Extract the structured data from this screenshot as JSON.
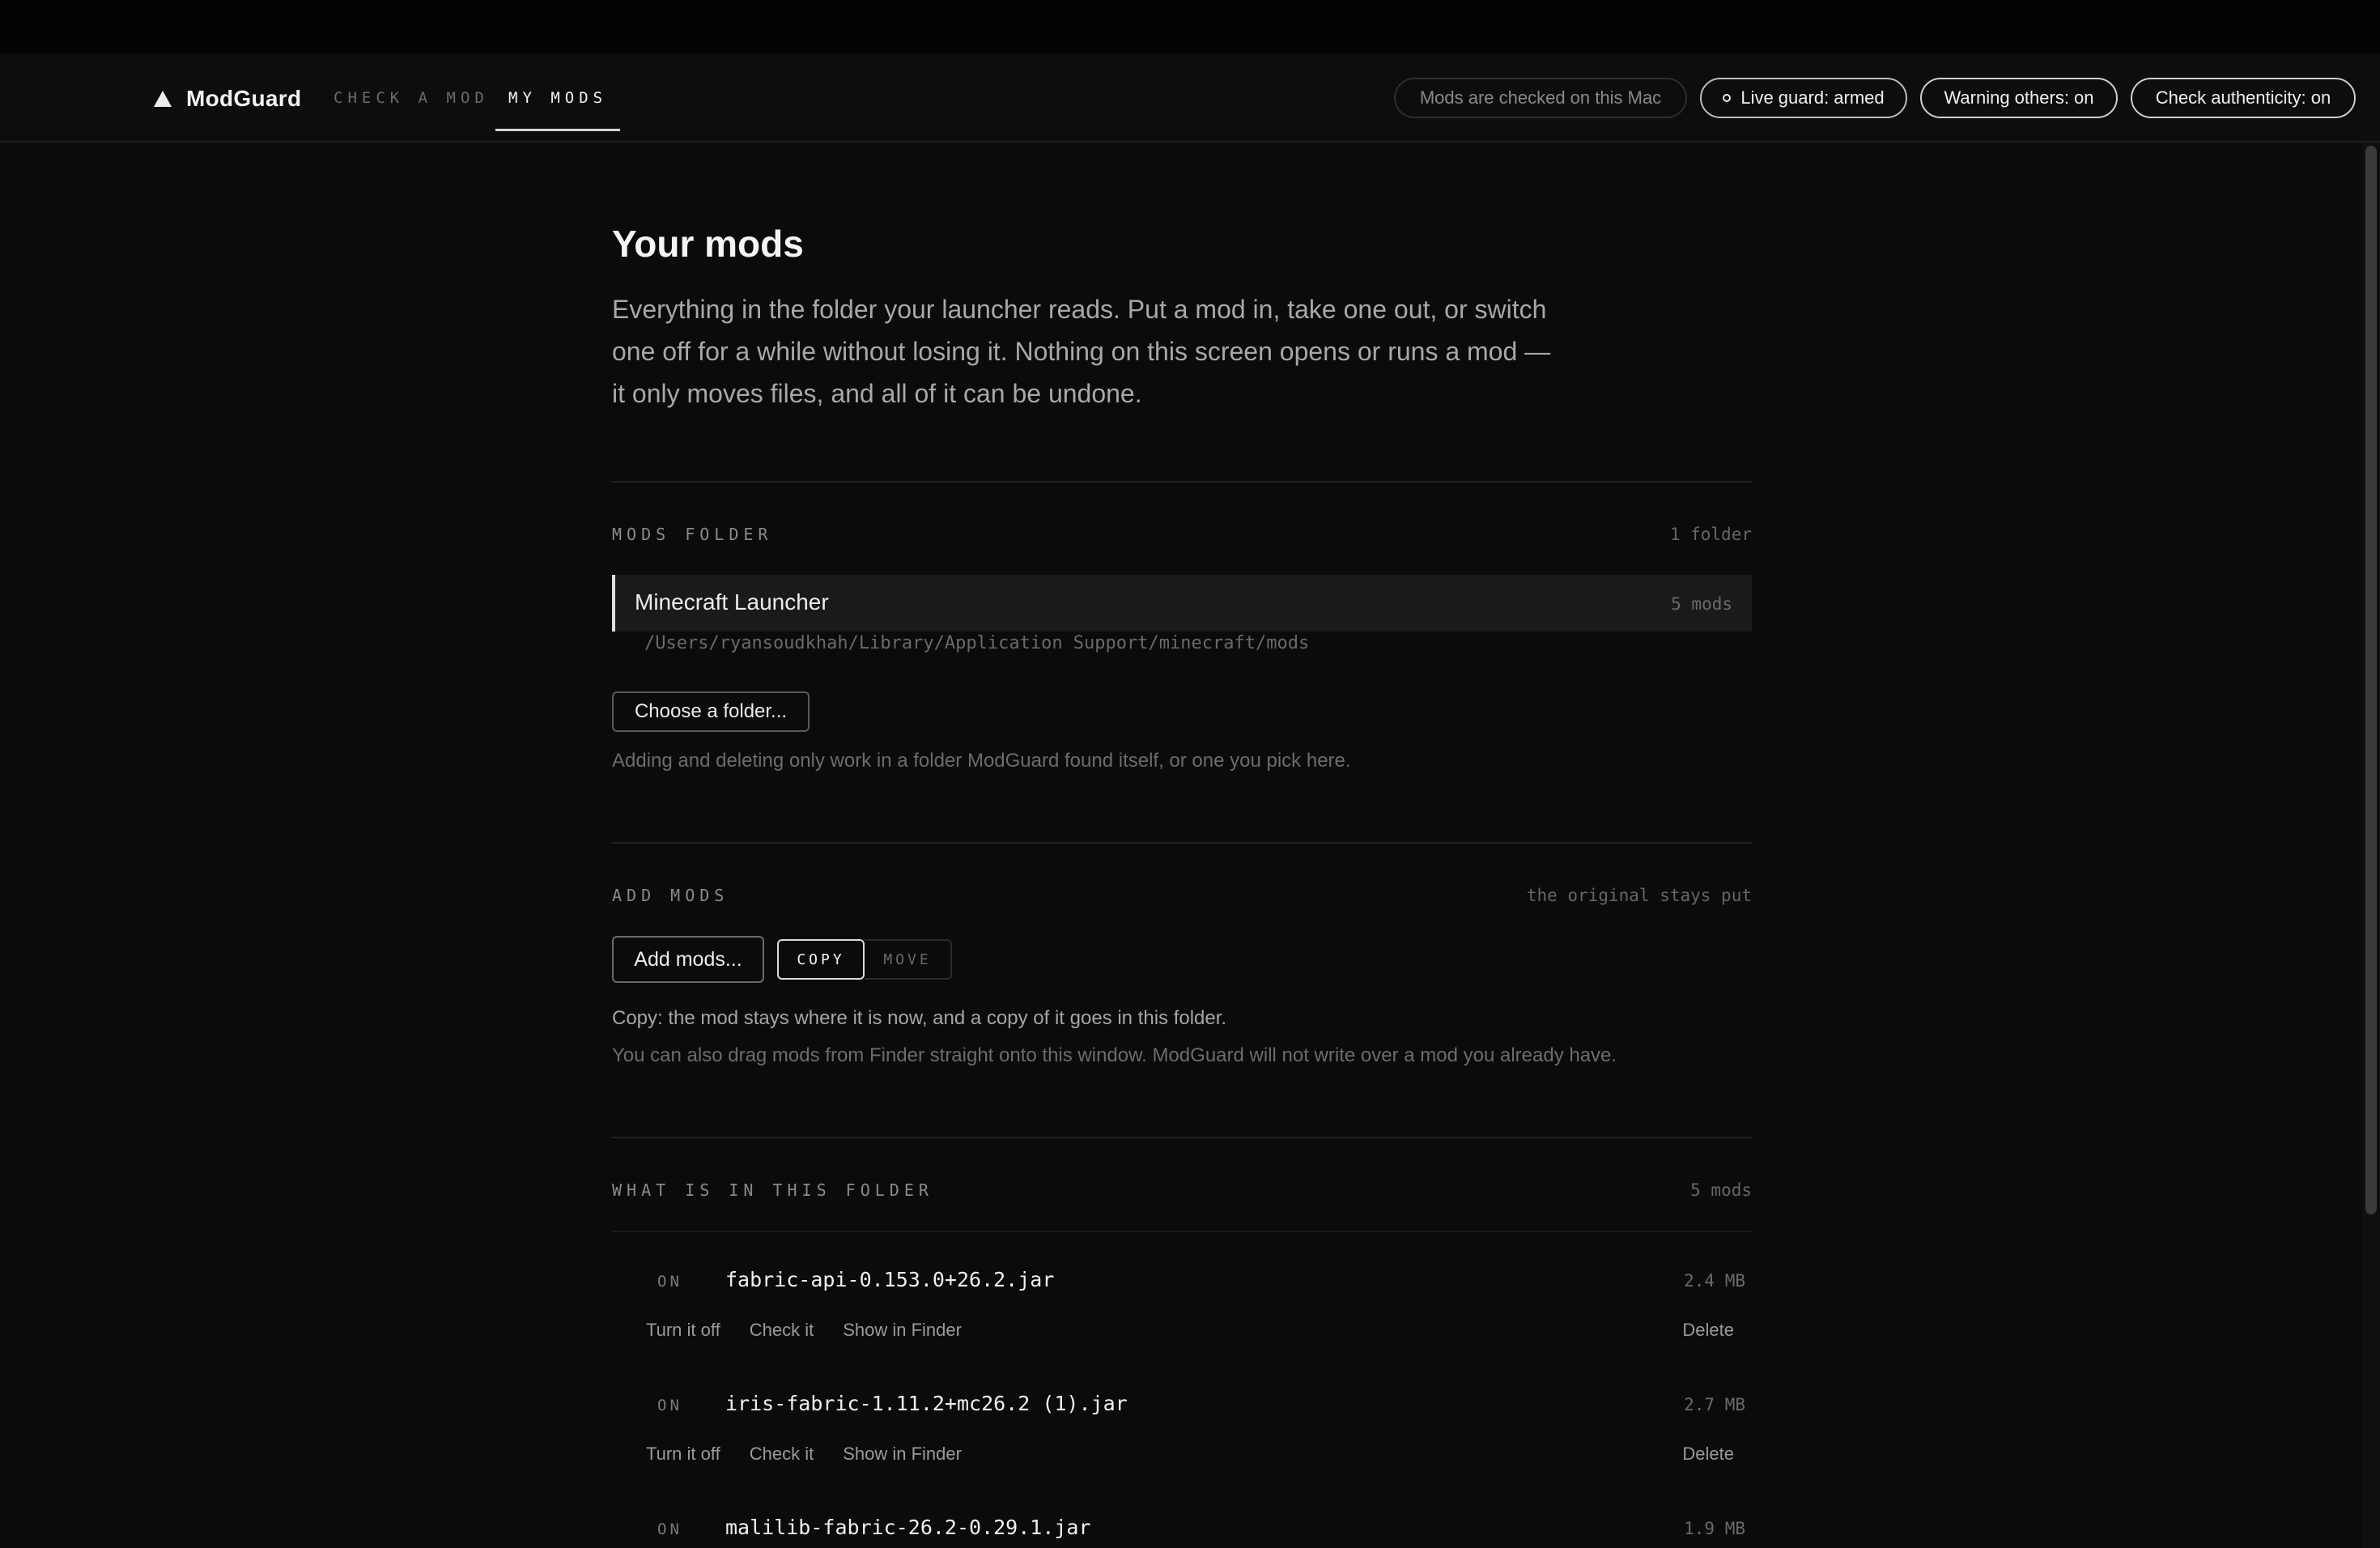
{
  "app": {
    "name": "ModGuard",
    "nav": {
      "check_label": "CHECK A MOD",
      "mine_label": "MY MODS"
    }
  },
  "status_pills": {
    "local": "Mods are checked on this Mac",
    "guard": "Live guard: armed",
    "warn": "Warning others: on",
    "auth": "Check authenticity: on"
  },
  "page": {
    "title": "Your mods",
    "description": "Everything in the folder your launcher reads. Put a mod in, take one out, or switch one off for a while without losing it. Nothing on this screen opens or runs a mod — it only moves files, and all of it can be undone."
  },
  "mods_folder": {
    "label": "MODS FOLDER",
    "meta": "1 folder",
    "folder_name": "Minecraft Launcher",
    "folder_count": "5 mods",
    "folder_path": "/Users/ryansoudkhah/Library/Application Support/minecraft/mods",
    "choose_label": "Choose a folder...",
    "hint": "Adding and deleting only work in a folder ModGuard found itself, or one you pick here."
  },
  "add_mods": {
    "label": "ADD MODS",
    "meta": "the original stays put",
    "add_label": "Add mods...",
    "copy_label": "COPY",
    "move_label": "MOVE",
    "copy_note": "Copy: the mod stays where it is now, and a copy of it goes in this folder.",
    "drag_hint": "You can also drag mods from Finder straight onto this window. ModGuard will not write over a mod you already have."
  },
  "folder_contents": {
    "label": "WHAT IS IN THIS FOLDER",
    "meta": "5 mods",
    "actions": {
      "turn_off": "Turn it off",
      "check": "Check it",
      "show": "Show in Finder",
      "delete": "Delete"
    },
    "mods": [
      {
        "status": "ON",
        "name": "fabric-api-0.153.0+26.2.jar",
        "size": "2.4 MB"
      },
      {
        "status": "ON",
        "name": "iris-fabric-1.11.2+mc26.2 (1).jar",
        "size": "2.7 MB"
      },
      {
        "status": "ON",
        "name": "malilib-fabric-26.2-0.29.1.jar",
        "size": "1.9 MB"
      }
    ]
  }
}
